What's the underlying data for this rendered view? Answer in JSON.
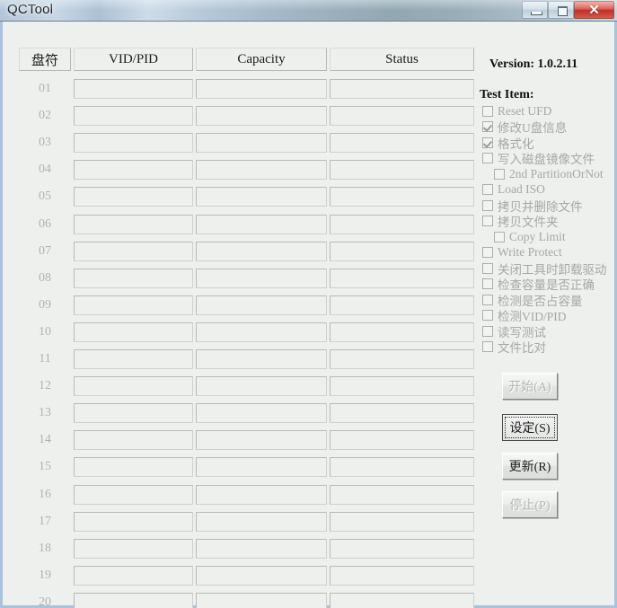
{
  "window": {
    "title": "QCTool",
    "controls": {
      "minimize_label": "Minimize",
      "maximize_label": "Maximize",
      "close_label": "✕"
    },
    "accent_border_color": "#a8c2e0",
    "close_button_color": "#d9574c"
  },
  "grid": {
    "columns": [
      "盘符",
      "VID/PID",
      "Capacity",
      "Status"
    ],
    "rows": [
      {
        "num": "01",
        "vidpid": "",
        "capacity": "",
        "status": ""
      },
      {
        "num": "02",
        "vidpid": "",
        "capacity": "",
        "status": ""
      },
      {
        "num": "03",
        "vidpid": "",
        "capacity": "",
        "status": ""
      },
      {
        "num": "04",
        "vidpid": "",
        "capacity": "",
        "status": ""
      },
      {
        "num": "05",
        "vidpid": "",
        "capacity": "",
        "status": ""
      },
      {
        "num": "06",
        "vidpid": "",
        "capacity": "",
        "status": ""
      },
      {
        "num": "07",
        "vidpid": "",
        "capacity": "",
        "status": ""
      },
      {
        "num": "08",
        "vidpid": "",
        "capacity": "",
        "status": ""
      },
      {
        "num": "09",
        "vidpid": "",
        "capacity": "",
        "status": ""
      },
      {
        "num": "10",
        "vidpid": "",
        "capacity": "",
        "status": ""
      },
      {
        "num": "11",
        "vidpid": "",
        "capacity": "",
        "status": ""
      },
      {
        "num": "12",
        "vidpid": "",
        "capacity": "",
        "status": ""
      },
      {
        "num": "13",
        "vidpid": "",
        "capacity": "",
        "status": ""
      },
      {
        "num": "14",
        "vidpid": "",
        "capacity": "",
        "status": ""
      },
      {
        "num": "15",
        "vidpid": "",
        "capacity": "",
        "status": ""
      },
      {
        "num": "16",
        "vidpid": "",
        "capacity": "",
        "status": ""
      },
      {
        "num": "17",
        "vidpid": "",
        "capacity": "",
        "status": ""
      },
      {
        "num": "18",
        "vidpid": "",
        "capacity": "",
        "status": ""
      },
      {
        "num": "19",
        "vidpid": "",
        "capacity": "",
        "status": ""
      },
      {
        "num": "20",
        "vidpid": "",
        "capacity": "",
        "status": ""
      }
    ]
  },
  "side": {
    "version": "Version: 1.0.2.11",
    "test_item_label": "Test Item:",
    "checkboxes": [
      {
        "label": "Reset UFD",
        "checked": false,
        "indent": false
      },
      {
        "label": "修改U盘信息",
        "checked": true,
        "indent": false
      },
      {
        "label": "格式化",
        "checked": true,
        "indent": false
      },
      {
        "label": "写入磁盘镜像文件",
        "checked": false,
        "indent": false
      },
      {
        "label": "2nd PartitionOrNot",
        "checked": false,
        "indent": true
      },
      {
        "label": "Load ISO",
        "checked": false,
        "indent": false
      },
      {
        "label": "拷贝并删除文件",
        "checked": false,
        "indent": false
      },
      {
        "label": "拷贝文件夹",
        "checked": false,
        "indent": false
      },
      {
        "label": "Copy Limit",
        "checked": false,
        "indent": true
      },
      {
        "label": "Write Protect",
        "checked": false,
        "indent": false
      },
      {
        "label": "关闭工具时卸载驱动",
        "checked": false,
        "indent": false
      },
      {
        "label": "检查容量是否正确",
        "checked": false,
        "indent": false
      },
      {
        "label": "检测是否占容量",
        "checked": false,
        "indent": false
      },
      {
        "label": "检测VID/PID",
        "checked": false,
        "indent": false
      },
      {
        "label": "读写测试",
        "checked": false,
        "indent": false
      },
      {
        "label": "文件比对",
        "checked": false,
        "indent": false
      }
    ],
    "buttons": {
      "start": "开始(A)",
      "set": "设定(S)",
      "update": "更新(R)",
      "stop": "停止(P)"
    }
  }
}
